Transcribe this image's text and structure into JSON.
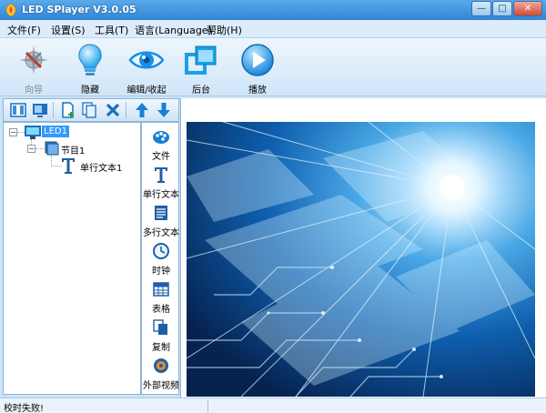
{
  "window": {
    "title": "LED SPlayer V3.0.05",
    "controls": {
      "minimize": "—",
      "maximize": "□",
      "close": "✕"
    }
  },
  "menu": {
    "items": [
      {
        "label": "文件(F)"
      },
      {
        "label": "设置(S)"
      },
      {
        "label": "工具(T)"
      },
      {
        "label": "语言(Language)"
      },
      {
        "label": "帮助(H)"
      }
    ]
  },
  "toolbar": {
    "items": [
      {
        "label": "向导",
        "icon": "wizard-icon",
        "enabled": false
      },
      {
        "label": "隐藏",
        "icon": "lightbulb-icon",
        "enabled": true
      },
      {
        "label": "编辑/收起",
        "icon": "eye-icon",
        "enabled": true
      },
      {
        "label": "后台",
        "icon": "windows-icon",
        "enabled": true
      },
      {
        "label": "播放",
        "icon": "play-icon",
        "enabled": true
      }
    ]
  },
  "sidebar_tools": {
    "icons": [
      "film-icon",
      "screen-icon",
      "new-page-icon",
      "copy-pages-icon",
      "delete-icon",
      "move-up-icon",
      "move-down-icon"
    ]
  },
  "tree": {
    "screen": {
      "label": "LED1",
      "expander": "−"
    },
    "program": {
      "label": "节目1",
      "expander": "−"
    },
    "item": {
      "label": "单行文本1"
    }
  },
  "add_panel": {
    "items": [
      {
        "label": "文件",
        "icon": "file-icon"
      },
      {
        "label": "单行文本",
        "icon": "text-icon"
      },
      {
        "label": "多行文本",
        "icon": "multiline-text-icon"
      },
      {
        "label": "时钟",
        "icon": "clock-icon"
      },
      {
        "label": "表格",
        "icon": "table-icon"
      },
      {
        "label": "复制",
        "icon": "copy-icon"
      },
      {
        "label": "外部视频",
        "icon": "video-icon"
      }
    ]
  },
  "status": {
    "message": "校时失败!"
  },
  "colors": {
    "title_bar": "#2f86d6",
    "tree_selected": "#3399ff",
    "accent_blue": "#1a8ee8"
  }
}
